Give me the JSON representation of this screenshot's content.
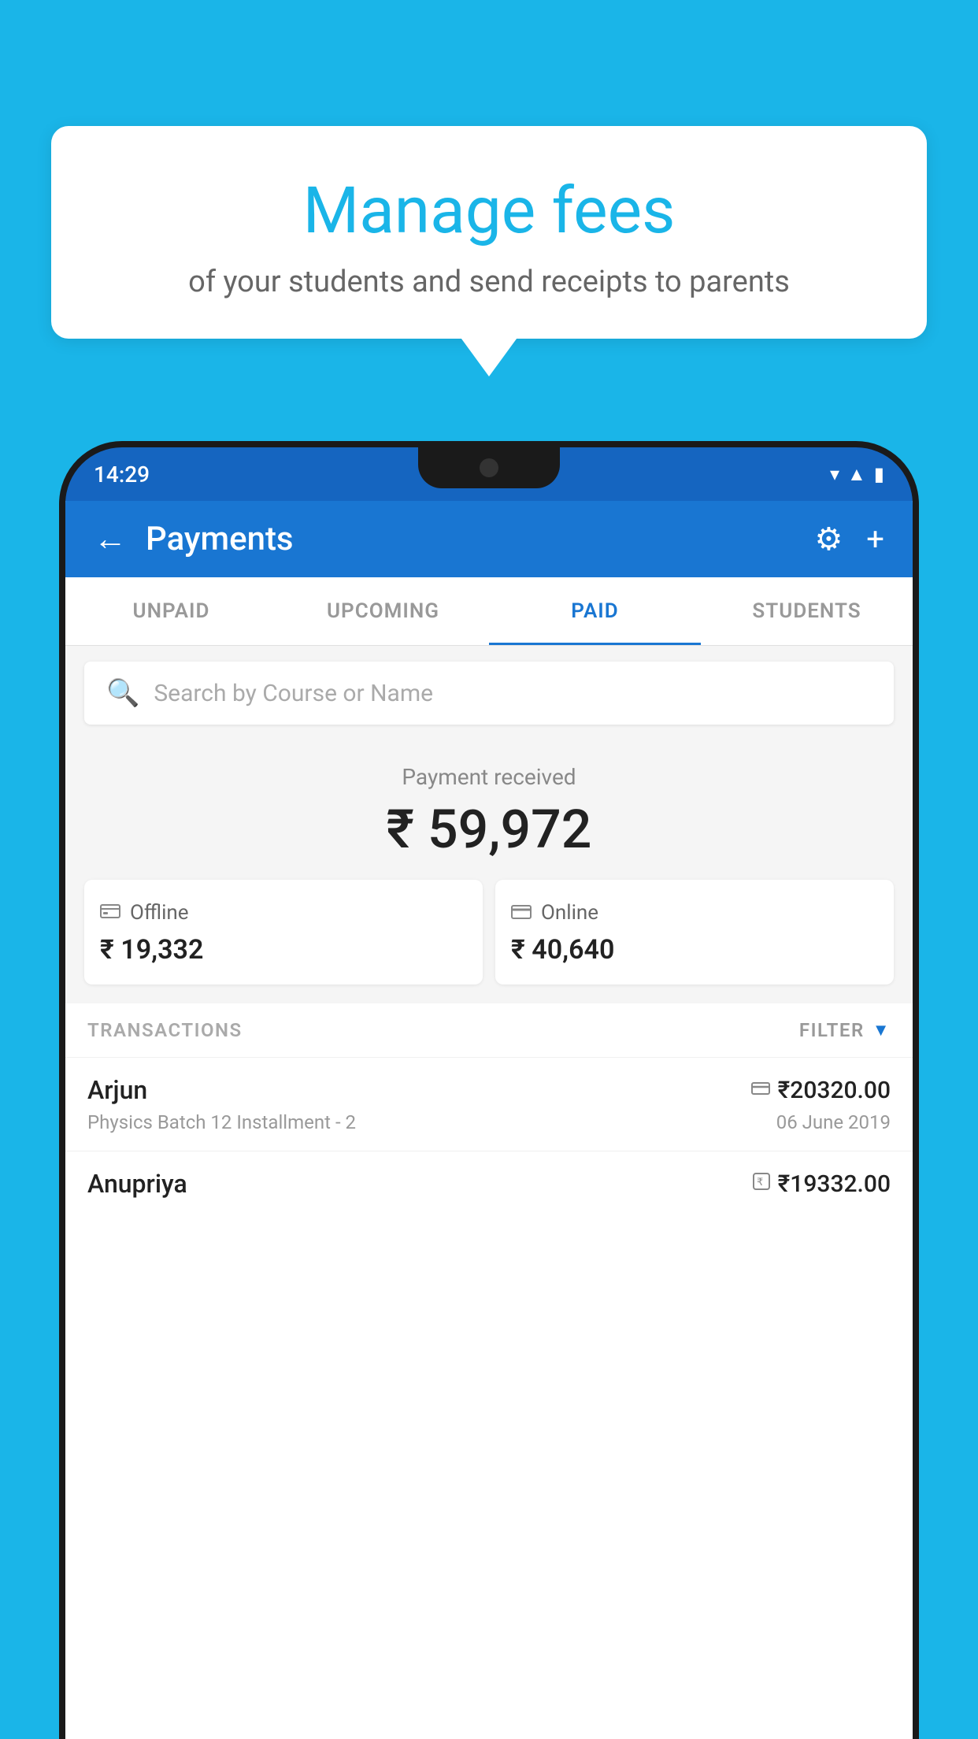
{
  "background_color": "#1ab5e8",
  "speech_bubble": {
    "title": "Manage fees",
    "subtitle": "of your students and send receipts to parents"
  },
  "status_bar": {
    "time": "14:29",
    "icons": [
      "wifi",
      "signal",
      "battery"
    ]
  },
  "header": {
    "title": "Payments",
    "back_label": "←",
    "gear_label": "⚙",
    "plus_label": "+"
  },
  "tabs": [
    {
      "label": "UNPAID",
      "active": false
    },
    {
      "label": "UPCOMING",
      "active": false
    },
    {
      "label": "PAID",
      "active": true
    },
    {
      "label": "STUDENTS",
      "active": false
    }
  ],
  "search": {
    "placeholder": "Search by Course or Name"
  },
  "payment_summary": {
    "label": "Payment received",
    "total": "₹ 59,972",
    "offline": {
      "icon": "💳",
      "label": "Offline",
      "amount": "₹ 19,332"
    },
    "online": {
      "icon": "💳",
      "label": "Online",
      "amount": "₹ 40,640"
    }
  },
  "transactions": {
    "label": "TRANSACTIONS",
    "filter_label": "FILTER",
    "items": [
      {
        "name": "Arjun",
        "course": "Physics Batch 12 Installment - 2",
        "amount": "₹20320.00",
        "date": "06 June 2019",
        "payment_type": "online"
      },
      {
        "name": "Anupriya",
        "course": "",
        "amount": "₹19332.00",
        "date": "",
        "payment_type": "offline"
      }
    ]
  }
}
